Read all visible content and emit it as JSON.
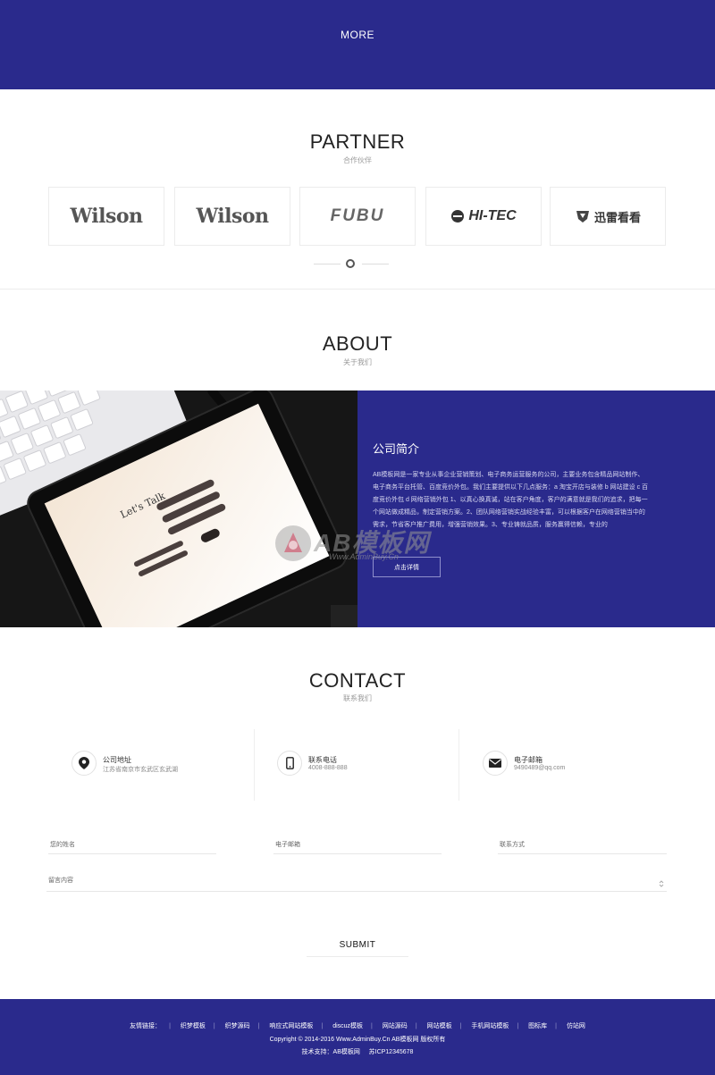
{
  "top": {
    "more_label": "MORE"
  },
  "partner": {
    "title": "PARTNER",
    "subtitle": "合作伙伴",
    "logos": [
      {
        "name": "Wilson",
        "kind": "wilson"
      },
      {
        "name": "Wilson",
        "kind": "wilson"
      },
      {
        "name": "FUBU",
        "kind": "fubu"
      },
      {
        "name": "HI-TEC",
        "kind": "hitec"
      },
      {
        "name": "迅雷看看",
        "kind": "xunlei"
      }
    ]
  },
  "about": {
    "title": "ABOUT",
    "subtitle": "关于我们",
    "panel_title": "公司简介",
    "description": "AB模板网是一家专业从事企业营销策划、电子商务运营服务的公司，主要业务包含精品网站制作、电子商务平台托管、百度竞价外包。我们主要提供以下几点服务：a 淘宝开店与装修 b 网站建设 c 百度竞价外包 d 网络营销外包 1、以真心换真诚，站在客户角度，客户的满意就是我们的追求，把每一个网站做成精品，制定营销方案。2、团队网络营销实战经验丰富，可以根据客户在网络营销当中的需求，节省客户推广费用，增强营销效果。3、专业铸就品质，服务赢得信赖，专业的",
    "button_label": "点击详情",
    "tablet_text": "Let's Talk"
  },
  "watermark": {
    "main": "AB模板网",
    "url": "Www.AdminBuy.Cn"
  },
  "contact": {
    "title": "CONTACT",
    "subtitle": "联系我们",
    "items": [
      {
        "label": "公司地址",
        "value": "江苏省南京市玄武区玄武湖",
        "icon": "location-pin-icon"
      },
      {
        "label": "联系电话",
        "value": "4008-888-888",
        "icon": "phone-icon"
      },
      {
        "label": "电子邮箱",
        "value": "9490489@qq.com",
        "icon": "mail-icon"
      }
    ],
    "form": {
      "name_placeholder": "您的姓名",
      "email_placeholder": "电子邮箱",
      "phone_placeholder": "联系方式",
      "message_placeholder": "留言内容",
      "submit_label": "SUBMIT"
    }
  },
  "footer": {
    "links_label": "友情链接：",
    "links": [
      "织梦模板",
      "织梦源码",
      "响应式网站模板",
      "discuz模板",
      "网站源码",
      "网站模板",
      "手机网站模板",
      "图标库",
      "仿站网"
    ],
    "copyright": "Copyright © 2014-2016 Www.AdminBuy.Cn AB模板网 版权所有",
    "tech_support": "技术支持：AB模板网",
    "icp": "苏ICP12345678"
  },
  "colors": {
    "brand": "#2a2a8c",
    "background": "#ffffff"
  }
}
